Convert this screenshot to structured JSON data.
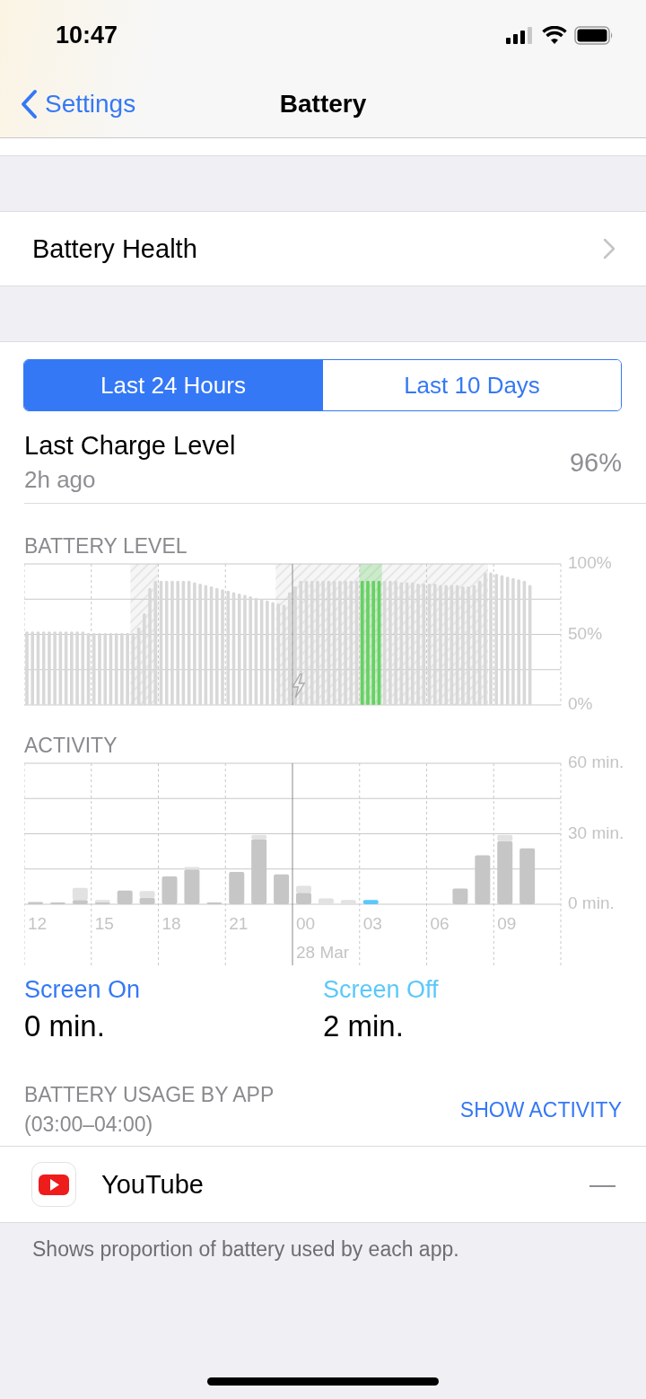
{
  "status_bar": {
    "time": "10:47"
  },
  "nav": {
    "back": "Settings",
    "title": "Battery"
  },
  "battery_health": {
    "label": "Battery Health"
  },
  "range_tabs": [
    {
      "label": "Last 24 Hours",
      "selected": true
    },
    {
      "label": "Last 10 Days",
      "selected": false
    }
  ],
  "last_charge": {
    "title": "Last Charge Level",
    "time": "2h ago",
    "value": "96%"
  },
  "battery_level": {
    "heading": "BATTERY LEVEL",
    "chart_data": {
      "type": "bar",
      "ylim": [
        0,
        100
      ],
      "yticks": [
        {
          "value": 0,
          "label": "0%"
        },
        {
          "value": 50,
          "label": "50%"
        },
        {
          "value": 100,
          "label": "100%"
        }
      ],
      "series": [
        {
          "color": "#d8d8d8",
          "values": [
            52,
            52,
            52,
            52,
            52,
            52,
            52,
            52,
            52,
            52,
            52,
            51,
            51,
            51,
            51,
            51,
            51,
            51,
            51,
            51,
            55,
            65,
            83,
            88,
            88,
            88,
            88,
            88,
            88,
            88,
            87,
            86,
            85,
            84,
            83,
            82,
            81,
            80,
            79,
            78,
            77,
            76,
            75,
            74,
            73,
            72,
            71,
            80,
            84,
            88,
            88,
            88,
            88,
            88,
            88,
            88,
            88,
            88,
            88,
            88,
            null,
            null,
            null,
            null,
            88,
            88,
            88,
            87,
            87,
            87,
            86,
            86,
            86,
            86,
            85,
            85,
            85,
            85,
            84,
            84,
            85,
            88,
            94,
            94,
            93,
            92,
            91,
            90,
            89,
            88,
            85,
            null,
            null,
            null,
            null,
            null
          ]
        },
        {
          "color": "#66d163",
          "values": [
            null,
            null,
            null,
            null,
            null,
            null,
            null,
            null,
            null,
            null,
            null,
            null,
            null,
            null,
            null,
            null,
            null,
            null,
            null,
            null,
            null,
            null,
            null,
            null,
            null,
            null,
            null,
            null,
            null,
            null,
            null,
            null,
            null,
            null,
            null,
            null,
            null,
            null,
            null,
            null,
            null,
            null,
            null,
            null,
            null,
            null,
            null,
            null,
            null,
            null,
            null,
            null,
            null,
            null,
            null,
            null,
            null,
            null,
            null,
            null,
            88,
            88,
            88,
            88,
            null,
            null,
            null,
            null,
            null,
            null,
            null,
            null,
            null,
            null,
            null,
            null,
            null,
            null,
            null,
            null,
            null,
            null,
            null,
            null,
            null,
            null,
            null,
            null,
            null,
            null,
            null,
            null,
            null,
            null,
            null,
            null
          ]
        }
      ]
    }
  },
  "activity": {
    "heading": "ACTIVITY",
    "date_label": "28 Mar",
    "chart_data": {
      "type": "bar",
      "stacked": true,
      "ylim": [
        0,
        60
      ],
      "categories": [
        "12",
        null,
        null,
        "15",
        null,
        null,
        "18",
        null,
        null,
        "21",
        null,
        null,
        "00",
        null,
        null,
        "03",
        null,
        null,
        "06",
        null,
        null,
        "09",
        null,
        null
      ],
      "yticks": [
        {
          "value": 0,
          "label": "0 min."
        },
        {
          "value": 30,
          "label": "30 min."
        },
        {
          "value": 60,
          "label": "60 min."
        }
      ],
      "series": [
        {
          "color": "#c6c6c6",
          "values": [
            1,
            0.8,
            1.8,
            0.9,
            5.8,
            2.8,
            11.8,
            14.8,
            0.8,
            13.8,
            27.7,
            12.7,
            4.9,
            0,
            0,
            0,
            0,
            0,
            0,
            6.7,
            20.8,
            26.8,
            23.8,
            null
          ]
        },
        {
          "color": "#e2e2e2",
          "values": [
            0,
            0,
            5.2,
            0.9,
            0,
            2.8,
            0,
            1.1,
            0,
            0,
            1.8,
            0,
            2.9,
            2.5,
            1.8,
            null,
            0,
            0,
            0,
            0,
            0,
            2.7,
            0,
            null
          ]
        },
        {
          "color": "#5ac8fa",
          "values": [
            null,
            null,
            null,
            null,
            null,
            null,
            null,
            null,
            null,
            null,
            null,
            null,
            null,
            null,
            null,
            1.8,
            null,
            null,
            null,
            null,
            null,
            null,
            null,
            null
          ]
        }
      ]
    }
  },
  "screen_time": [
    {
      "kind": "on",
      "label": "Screen On",
      "value": "0 min."
    },
    {
      "kind": "off",
      "label": "Screen Off",
      "value": "2 min."
    }
  ],
  "usage": {
    "heading": "BATTERY USAGE BY APP",
    "range": "(03:00–04:00)",
    "action": "SHOW ACTIVITY"
  },
  "apps": [
    {
      "name": "YouTube",
      "usage": "—"
    }
  ],
  "footer": "Shows proportion of battery used by each app."
}
